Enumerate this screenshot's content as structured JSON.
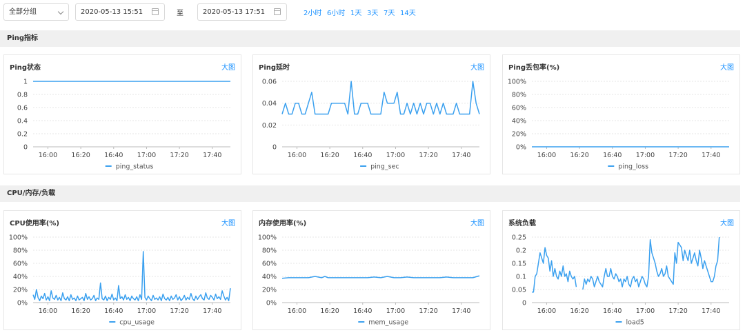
{
  "toolbar": {
    "group_select": "全部分组",
    "start_time": "2020-05-13 15:51",
    "separator": "至",
    "end_time": "2020-05-13 17:51",
    "quick_ranges": [
      "2小时",
      "6小时",
      "1天",
      "3天",
      "7天",
      "14天"
    ]
  },
  "sections": {
    "ping": "Ping指标",
    "cpu": "CPU/内存/负载"
  },
  "colors": {
    "accent": "#1890ff",
    "series": "#3aa0ef"
  },
  "chart_data": [
    {
      "type": "line",
      "title": "Ping状态",
      "link": "大图",
      "x": [
        0,
        2,
        4,
        6,
        8,
        10,
        12,
        14,
        16,
        18,
        20,
        22,
        24,
        26,
        28,
        30,
        32,
        34,
        36,
        38,
        40,
        42,
        44,
        46,
        48,
        50,
        52,
        54,
        56,
        58,
        60,
        62,
        64,
        66,
        68,
        70,
        72,
        74,
        76,
        78,
        80,
        82,
        84,
        86,
        88,
        90,
        92,
        94,
        96,
        98,
        100,
        102,
        104,
        106,
        108,
        110,
        112,
        114,
        116,
        118,
        120
      ],
      "x_label_ticks": [
        "16:00",
        "16:20",
        "16:40",
        "17:00",
        "17:20",
        "17:40"
      ],
      "x_tick_positions": [
        9,
        29,
        49,
        69,
        89,
        109
      ],
      "xlim": [
        0,
        120
      ],
      "ylim": [
        0,
        1
      ],
      "y_ticks": [
        "0",
        "0.2",
        "0.4",
        "0.6",
        "0.8",
        "1"
      ],
      "series": [
        {
          "name": "ping_status",
          "values": [
            1,
            1,
            1,
            1,
            1,
            1,
            1,
            1,
            1,
            1,
            1,
            1,
            1,
            1,
            1,
            1,
            1,
            1,
            1,
            1,
            1,
            1,
            1,
            1,
            1,
            1,
            1,
            1,
            1,
            1,
            1,
            1,
            1,
            1,
            1,
            1,
            1,
            1,
            1,
            1,
            1,
            1,
            1,
            1,
            1,
            1,
            1,
            1,
            1,
            1,
            1,
            1,
            1,
            1,
            1,
            1,
            1,
            1,
            1,
            1,
            1
          ]
        }
      ]
    },
    {
      "type": "line",
      "title": "Ping延时",
      "link": "大图",
      "x": [
        0,
        2,
        4,
        6,
        8,
        10,
        12,
        14,
        16,
        18,
        20,
        22,
        24,
        26,
        28,
        30,
        32,
        34,
        36,
        38,
        40,
        42,
        44,
        46,
        48,
        50,
        52,
        54,
        56,
        58,
        60,
        62,
        64,
        66,
        68,
        70,
        72,
        74,
        76,
        78,
        80,
        82,
        84,
        86,
        88,
        90,
        92,
        94,
        96,
        98,
        100,
        102,
        104,
        106,
        108,
        110,
        112,
        114,
        116,
        118,
        120
      ],
      "x_label_ticks": [
        "16:00",
        "16:20",
        "16:40",
        "17:00",
        "17:20",
        "17:40"
      ],
      "x_tick_positions": [
        9,
        29,
        49,
        69,
        89,
        109
      ],
      "xlim": [
        0,
        120
      ],
      "ylim": [
        0,
        0.06
      ],
      "y_ticks": [
        "0",
        "0.02",
        "0.04",
        "0.06"
      ],
      "series": [
        {
          "name": "ping_sec",
          "values": [
            0.03,
            0.04,
            0.03,
            0.03,
            0.04,
            0.04,
            0.03,
            0.03,
            0.04,
            0.05,
            0.03,
            0.03,
            0.03,
            0.03,
            0.03,
            0.04,
            0.04,
            0.04,
            0.04,
            0.04,
            0.03,
            0.06,
            0.03,
            0.03,
            0.04,
            0.04,
            0.04,
            0.03,
            0.03,
            0.03,
            0.03,
            0.05,
            0.04,
            0.04,
            0.04,
            0.05,
            0.03,
            0.03,
            0.04,
            0.03,
            0.04,
            0.03,
            0.04,
            0.03,
            0.04,
            0.04,
            0.03,
            0.04,
            0.03,
            0.04,
            0.03,
            0.03,
            0.03,
            0.04,
            0.03,
            0.03,
            0.03,
            0.03,
            0.06,
            0.04,
            0.03
          ]
        }
      ]
    },
    {
      "type": "line",
      "title": "Ping丢包率(%)",
      "link": "大图",
      "x": [
        0,
        120
      ],
      "x_label_ticks": [
        "16:00",
        "16:20",
        "16:40",
        "17:00",
        "17:20",
        "17:40"
      ],
      "x_tick_positions": [
        9,
        29,
        49,
        69,
        89,
        109
      ],
      "xlim": [
        0,
        120
      ],
      "ylim": [
        0,
        100
      ],
      "y_ticks": [
        "0%",
        "20%",
        "40%",
        "60%",
        "80%",
        "100%"
      ],
      "series": [
        {
          "name": "ping_loss",
          "values": [
            0,
            0
          ]
        }
      ]
    },
    {
      "type": "line",
      "title": "CPU使用率(%)",
      "link": "大图",
      "x": [
        0,
        1,
        2,
        3,
        4,
        5,
        6,
        7,
        8,
        9,
        10,
        11,
        12,
        13,
        14,
        15,
        16,
        17,
        18,
        19,
        20,
        21,
        22,
        23,
        24,
        25,
        26,
        27,
        28,
        29,
        30,
        31,
        32,
        33,
        34,
        35,
        36,
        37,
        38,
        39,
        40,
        41,
        42,
        43,
        44,
        45,
        46,
        47,
        48,
        49,
        50,
        51,
        52,
        53,
        54,
        55,
        56,
        57,
        58,
        59,
        60,
        61,
        62,
        63,
        64,
        65,
        66,
        67,
        68,
        69,
        70,
        71,
        72,
        73,
        74,
        75,
        76,
        77,
        78,
        79,
        80,
        81,
        82,
        83,
        84,
        85,
        86,
        87,
        88,
        89,
        90,
        91,
        92,
        93,
        94,
        95,
        96,
        97,
        98,
        99,
        100,
        101,
        102,
        103,
        104,
        105,
        106,
        107,
        108,
        109,
        110,
        111,
        112,
        113,
        114,
        115,
        116,
        117,
        118,
        119,
        120
      ],
      "x_label_ticks": [
        "16:00",
        "16:20",
        "16:40",
        "17:00",
        "17:20",
        "17:40"
      ],
      "x_tick_positions": [
        9,
        29,
        49,
        69,
        89,
        109
      ],
      "xlim": [
        0,
        120
      ],
      "ylim": [
        0,
        100
      ],
      "y_ticks": [
        "0%",
        "20%",
        "40%",
        "60%",
        "80%",
        "100%"
      ],
      "series": [
        {
          "name": "cpu_usage",
          "values": [
            12,
            5,
            20,
            8,
            3,
            10,
            6,
            14,
            4,
            9,
            3,
            18,
            7,
            5,
            11,
            4,
            8,
            3,
            15,
            6,
            4,
            9,
            3,
            12,
            5,
            7,
            3,
            10,
            4,
            6,
            8,
            3,
            14,
            5,
            9,
            4,
            6,
            11,
            3,
            7,
            5,
            30,
            6,
            4,
            10,
            3,
            8,
            5,
            13,
            4,
            7,
            3,
            26,
            6,
            9,
            4,
            12,
            5,
            8,
            3,
            10,
            6,
            4,
            9,
            3,
            12,
            5,
            78,
            8,
            4,
            10,
            6,
            3,
            11,
            5,
            7,
            4,
            9,
            3,
            13,
            6,
            4,
            8,
            3,
            10,
            5,
            7,
            12,
            4,
            9,
            3,
            6,
            11,
            4,
            8,
            5,
            14,
            6,
            3,
            10,
            5,
            9,
            12,
            6,
            4,
            15,
            7,
            5,
            11,
            8,
            4,
            13,
            6,
            9,
            5,
            18,
            10,
            4,
            8,
            3,
            22
          ]
        }
      ]
    },
    {
      "type": "line",
      "title": "内存使用率(%)",
      "link": "大图",
      "x": [
        0,
        4,
        8,
        12,
        16,
        20,
        24,
        26,
        28,
        30,
        34,
        36,
        40,
        44,
        48,
        52,
        56,
        60,
        64,
        68,
        72,
        76,
        80,
        84,
        88,
        92,
        96,
        100,
        104,
        108,
        112,
        116,
        120
      ],
      "x_label_ticks": [
        "16:00",
        "16:20",
        "16:40",
        "17:00",
        "17:20",
        "17:40"
      ],
      "x_tick_positions": [
        9,
        29,
        49,
        69,
        89,
        109
      ],
      "xlim": [
        0,
        120
      ],
      "ylim": [
        0,
        100
      ],
      "y_ticks": [
        "0%",
        "20%",
        "40%",
        "60%",
        "80%",
        "100%"
      ],
      "series": [
        {
          "name": "mem_usage",
          "values": [
            37,
            38,
            38,
            38,
            38,
            40,
            38,
            40,
            38,
            38,
            38,
            38,
            38,
            38,
            38,
            38,
            39,
            38,
            40,
            38,
            38,
            39,
            38,
            38,
            38,
            38,
            38,
            39,
            38,
            38,
            38,
            38,
            41
          ]
        }
      ]
    },
    {
      "type": "line",
      "title": "系统负载",
      "link": "大图",
      "x": [
        0,
        1,
        2,
        3,
        4,
        5,
        6,
        7,
        8,
        9,
        10,
        11,
        12,
        13,
        14,
        15,
        16,
        17,
        18,
        19,
        20,
        21,
        22,
        23,
        24,
        25,
        26,
        27,
        28,
        29,
        30,
        31,
        32,
        33,
        34,
        35,
        36,
        37,
        38,
        39,
        40,
        41,
        42,
        43,
        44,
        45,
        46,
        47,
        48,
        49,
        50,
        51,
        52,
        53,
        54,
        55,
        56,
        57,
        58,
        59,
        60,
        61,
        62,
        63,
        64,
        65,
        66,
        67,
        68,
        69,
        70,
        71,
        72,
        73,
        74,
        75,
        76,
        77,
        78,
        79,
        80,
        81,
        82,
        83,
        84,
        85,
        86,
        87,
        88,
        89,
        90,
        91,
        92,
        93,
        94,
        95,
        96,
        97,
        98,
        99,
        100,
        101,
        102,
        103,
        104,
        105,
        106,
        107,
        108,
        109,
        110,
        111,
        112,
        113,
        114,
        115,
        116,
        117,
        118,
        119,
        120
      ],
      "x_label_ticks": [
        "16:00",
        "16:20",
        "16:40",
        "17:00",
        "17:20",
        "17:40"
      ],
      "x_tick_positions": [
        9,
        29,
        49,
        69,
        89,
        109
      ],
      "xlim": [
        0,
        120
      ],
      "ylim": [
        0,
        0.25
      ],
      "y_ticks": [
        "0",
        "0.05",
        "0.1",
        "0.15",
        "0.2",
        "0.25"
      ],
      "series": [
        {
          "name": "load5",
          "values": [
            0.04,
            0.04,
            0.1,
            0.11,
            0.15,
            0.19,
            0.17,
            0.15,
            0.21,
            0.18,
            0.17,
            0.12,
            0.16,
            0.1,
            0.13,
            0.1,
            0.09,
            0.12,
            0.1,
            0.14,
            0.1,
            0.11,
            0.08,
            0.12,
            0.1,
            0.09,
            0.1,
            0.06,
            null,
            null,
            null,
            0.05,
            0.09,
            0.07,
            0.09,
            0.08,
            0.1,
            0.09,
            0.06,
            0.08,
            0.1,
            0.08,
            0.07,
            0.06,
            0.1,
            0.13,
            0.1,
            0.1,
            0.13,
            0.1,
            0.09,
            0.11,
            0.1,
            0.08,
            0.09,
            0.06,
            0.09,
            0.08,
            0.1,
            0.07,
            0.06,
            0.09,
            0.1,
            0.08,
            0.09,
            0.06,
            0.08,
            0.1,
            0.09,
            0.07,
            0.06,
            0.1,
            0.24,
            0.19,
            0.17,
            0.15,
            0.12,
            0.1,
            0.11,
            0.13,
            0.1,
            0.11,
            0.14,
            0.1,
            0.09,
            0.08,
            0.07,
            0.19,
            0.15,
            0.23,
            0.22,
            0.21,
            0.16,
            0.2,
            0.18,
            0.16,
            0.2,
            0.15,
            0.17,
            0.19,
            0.16,
            0.14,
            0.2,
            0.17,
            0.13,
            0.16,
            0.14,
            0.12,
            0.1,
            0.08,
            0.08,
            0.1,
            0.14,
            0.16,
            0.25
          ]
        }
      ]
    }
  ]
}
